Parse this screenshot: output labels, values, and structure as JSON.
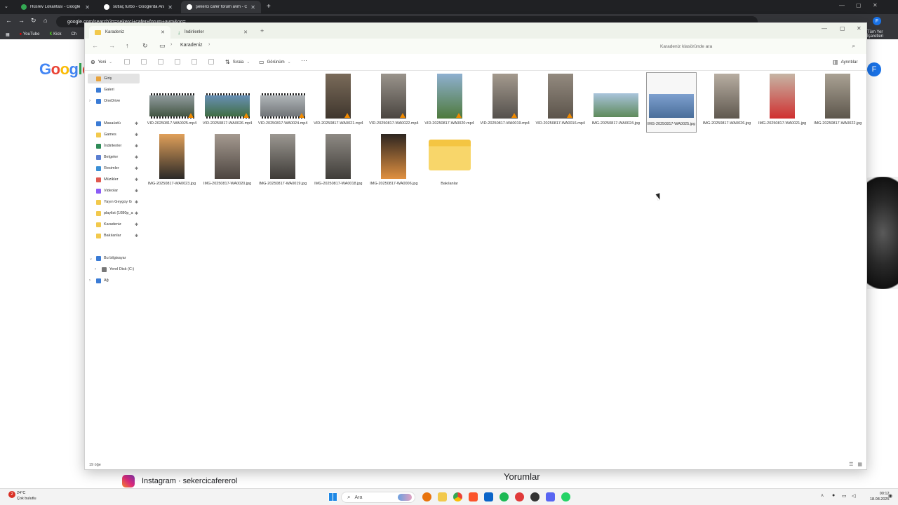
{
  "browser": {
    "tabs": [
      {
        "title": "Hüsrev Lokantası - Google Har",
        "active": false,
        "color": "#34a853"
      },
      {
        "title": "sütlaç turbo - Google'da Ara",
        "active": false,
        "color": "#ffffff"
      },
      {
        "title": "şekerci cafer forum avm - Goo",
        "active": true,
        "color": "#ffffff"
      }
    ],
    "url": "google.com/search?q=şekerci+cafer+forum+avm&oq=...",
    "bookmarks": [
      "YouTube",
      "Kick",
      "Ch"
    ],
    "bookmarks_right": "Tüm Yer İşaretleri",
    "profile_initial": "F"
  },
  "background_page": {
    "logo": "Google",
    "instagram_title": "Instagram · sekercicafererol",
    "comments_label": "Yorumlar"
  },
  "explorer": {
    "tabs": [
      {
        "label": "Karadeniz",
        "active": true
      },
      {
        "label": "İndirilenler",
        "active": false
      }
    ],
    "breadcrumb": "Karadeniz",
    "search_placeholder": "Karadeniz klasöründe ara",
    "toolbar": {
      "new_label": "Yeni",
      "sort_label": "Sırala",
      "view_label": "Görünüm",
      "details_label": "Ayrıntılar"
    },
    "nav": [
      {
        "label": "Giriş",
        "icon": "home-icon",
        "color": "#e8a33d",
        "selected": true
      },
      {
        "label": "Galeri",
        "icon": "gallery-icon",
        "color": "#3a7bd5"
      },
      {
        "label": "OneDrive",
        "icon": "cloud-icon",
        "color": "#3a7bd5",
        "expander": true
      },
      {
        "label": "Masaüstü",
        "icon": "desktop-icon",
        "color": "#3a7bd5",
        "pinned": true
      },
      {
        "label": "Games",
        "icon": "folder-icon",
        "color": "#f2c94c",
        "pinned": true
      },
      {
        "label": "İndirilenler",
        "icon": "download-icon",
        "color": "#2e8b57",
        "pinned": true
      },
      {
        "label": "Belgeler",
        "icon": "documents-icon",
        "color": "#5b7fd1",
        "pinned": true
      },
      {
        "label": "Resimler",
        "icon": "pictures-icon",
        "color": "#3a8fd5",
        "pinned": true
      },
      {
        "label": "Müzikler",
        "icon": "music-icon",
        "color": "#e0584f",
        "pinned": true
      },
      {
        "label": "Videolar",
        "icon": "videos-icon",
        "color": "#8b5cf6",
        "pinned": true
      },
      {
        "label": "Yayın Geygoy G",
        "icon": "folder-icon",
        "color": "#f2c94c",
        "pinned": true
      },
      {
        "label": "playlist (1080p_a",
        "icon": "folder-icon",
        "color": "#f2c94c",
        "pinned": true
      },
      {
        "label": "Karadeniz",
        "icon": "folder-icon",
        "color": "#f2c94c",
        "pinned": true
      },
      {
        "label": "Bakılanlar",
        "icon": "folder-icon",
        "color": "#f2c94c",
        "pinned": true
      },
      {
        "label": "Bu bilgisayar",
        "icon": "computer-icon",
        "color": "#3a7bd5",
        "expanded": true
      },
      {
        "label": "Yerel Disk (C:)",
        "icon": "disk-icon",
        "color": "#777777",
        "expander": true
      },
      {
        "label": "Ağ",
        "icon": "network-icon",
        "color": "#3a7bd5",
        "expander": true
      }
    ],
    "files": [
      {
        "name": "VID-20250817-WA0025.mp4",
        "type": "video",
        "orient": "land",
        "palette": [
          "#9aa3a8",
          "#3b4f3a"
        ]
      },
      {
        "name": "VID-20250817-WA0026.mp4",
        "type": "video",
        "orient": "land",
        "palette": [
          "#6c93c0",
          "#3d6b3a"
        ]
      },
      {
        "name": "VID-20250817-WA0024.mp4",
        "type": "video",
        "orient": "land",
        "palette": [
          "#b7bcbf",
          "#6b6f72"
        ]
      },
      {
        "name": "VID-20250817-WA0021.mp4",
        "type": "video",
        "orient": "port",
        "palette": [
          "#7a6b5a",
          "#3f362d"
        ]
      },
      {
        "name": "VID-20250817-WA0022.mp4",
        "type": "video",
        "orient": "port",
        "palette": [
          "#9a948c",
          "#4a4540"
        ]
      },
      {
        "name": "VID-20250817-WA0020.mp4",
        "type": "video",
        "orient": "port",
        "palette": [
          "#8fb0d0",
          "#4e7a3c"
        ]
      },
      {
        "name": "VID-20250817-WA0019.mp4",
        "type": "video",
        "orient": "port",
        "palette": [
          "#a49a8e",
          "#54504c"
        ]
      },
      {
        "name": "VID-20250817-WA0016.mp4",
        "type": "video",
        "orient": "port",
        "palette": [
          "#938a7f",
          "#5c544b"
        ]
      },
      {
        "name": "IMG-20250817-WA0024.jpg",
        "type": "image",
        "orient": "land",
        "palette": [
          "#a9c4dc",
          "#5e8a5a"
        ]
      },
      {
        "name": "IMG-20250817-WA0025.jpg",
        "type": "image",
        "orient": "land",
        "palette": [
          "#7ea0cf",
          "#4a6e9a"
        ],
        "selected": true
      },
      {
        "name": "IMG-20250817-WA0026.jpg",
        "type": "image",
        "orient": "port",
        "palette": [
          "#b8aea2",
          "#5f584f"
        ]
      },
      {
        "name": "IMG-20250817-WA0021.jpg",
        "type": "image",
        "orient": "port",
        "palette": [
          "#c6b5a5",
          "#d03030"
        ]
      },
      {
        "name": "IMG-20250817-WA0022.jpg",
        "type": "image",
        "orient": "port",
        "palette": [
          "#aaa294",
          "#5d564c"
        ]
      },
      {
        "name": "IMG-20250817-WA0023.jpg",
        "type": "image",
        "orient": "port",
        "palette": [
          "#e0a05a",
          "#2c2a28"
        ]
      },
      {
        "name": "IMG-20250817-WA0020.jpg",
        "type": "image",
        "orient": "port",
        "palette": [
          "#a59a90",
          "#4d4540"
        ]
      },
      {
        "name": "IMG-20250817-WA0019.jpg",
        "type": "image",
        "orient": "port",
        "palette": [
          "#9c9892",
          "#3e3b37"
        ]
      },
      {
        "name": "IMG-20250817-WA0018.jpg",
        "type": "image",
        "orient": "port",
        "palette": [
          "#8e8a84",
          "#403d39"
        ]
      },
      {
        "name": "IMG-20250817-WA0006.jpg",
        "type": "image",
        "orient": "port",
        "palette": [
          "#2d2520",
          "#e09040"
        ]
      },
      {
        "name": "Bakılanlar",
        "type": "folder"
      }
    ],
    "status": "19 öğe"
  },
  "taskbar": {
    "weather_temp": "24°C",
    "weather_desc": "Çok bulutlu",
    "search_placeholder": "Ara",
    "time": "00:12",
    "date": "18.08.2025"
  }
}
